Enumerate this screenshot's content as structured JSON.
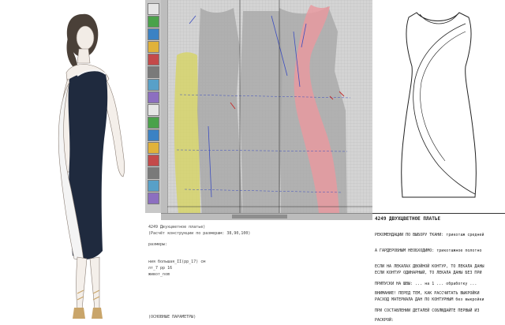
{
  "colors": {
    "dress_navy": "#1f2a3e",
    "insert_white": "#f4f4f4",
    "pattern_grey": "#9e9e9e",
    "pattern_pink": "#e79aa0",
    "pattern_yellow": "#d6d46a",
    "cad_bg": "#d4d4d4",
    "line_blue": "#3b4dbf",
    "line_red": "#c43030"
  },
  "toolbar": {
    "tools": [
      "select-icon",
      "line-icon",
      "curve-icon",
      "grid-icon",
      "pencil-icon",
      "scissors-icon",
      "measure-icon",
      "rotate-icon",
      "mirror-icon",
      "dart-icon",
      "notch-icon",
      "text-icon",
      "zoom-icon",
      "pan-icon",
      "layer-icon",
      "print-icon"
    ]
  },
  "cad_log": {
    "lines": [
      "4249 Двухцветное платье)",
      "(Расчёт конструкции по размерам: 38,90,100)",
      "размеры:",
      "ния большая_II(рр_17) см",
      "лт_7 рр 16",
      "живот_nom",
      "(ОСНОВНЫЕ ПАРАМЕТРЫ)"
    ]
  },
  "document": {
    "title": "4249 ДВУХЦВЕТНОЕ ПЛАТЬЕ",
    "lines": [
      "РЕКОМЕНДАЦИИ ПО ВЫБОРУ ТКАНИ: трикотаж средней",
      "А ГАРДЕРОБНЫМ НЕОБХОДИМО: трикотажное полотно",
      "ЕСЛИ НА ЛЕКАЛАХ ДВОЙНОЙ КОНТУР, ТО ЛЕКАЛА ДАНЫ",
      "ЕСЛИ КОНТУР ОДИНАРНЫЙ, ТО ЛЕКАЛА ДАНЫ БЕЗ ПРИ",
      "ПРИПУСКИ НА ШВЫ: ... на 1 ... обработку ...",
      "ВНИМАНИЕ! ПЕРЕД ТЕМ, КАК РАССЧИТАТЬ ВЫКРОЙКИ",
      "РАСХОД МАТЕРИАЛА ДАН ПО КОНТУРНЫМ без выкройки",
      "ПРИ СОСТАВЛЕНИИ ДЕТАЛЕЙ СОБЛЮДАЙТЕ ПЕРВЫЙ ИЗ",
      "РАСКРОЙ:"
    ]
  }
}
